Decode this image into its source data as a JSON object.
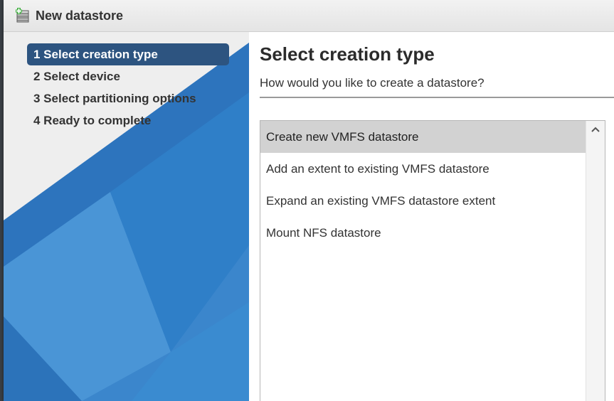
{
  "dialog": {
    "title": "New datastore",
    "icon": "datastore-add-icon"
  },
  "steps": [
    {
      "label": "1 Select creation type",
      "active": true
    },
    {
      "label": "2 Select device",
      "active": false
    },
    {
      "label": "3 Select partitioning options",
      "active": false
    },
    {
      "label": "4 Ready to complete",
      "active": false
    }
  ],
  "main": {
    "title": "Select creation type",
    "subtitle": "How would you like to create a datastore?",
    "options": [
      {
        "label": "Create new VMFS datastore",
        "selected": true
      },
      {
        "label": "Add an extent to existing VMFS datastore",
        "selected": false
      },
      {
        "label": "Expand an existing VMFS datastore extent",
        "selected": false
      },
      {
        "label": "Mount NFS datastore",
        "selected": false
      }
    ]
  },
  "colors": {
    "active_step": "#2d5480",
    "selected_option": "#d2d2d2",
    "sidebar_blue": "#2f7ec8"
  }
}
